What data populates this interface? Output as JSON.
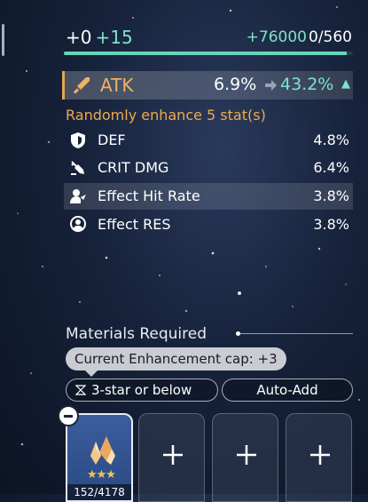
{
  "enhance": {
    "level_current": "+0",
    "level_added": "+15",
    "exp_gain": "+76000",
    "exp_value": "0/560",
    "exp_progress": 0.98
  },
  "main_stat": {
    "icon": "sword-icon",
    "name": "ATK",
    "from": "6.9%",
    "to": "43.2%",
    "trend_icon": "up-triangle-icon"
  },
  "random_note": "Randomly enhance 5 stat(s)",
  "substats": [
    {
      "icon": "shield-icon",
      "name": "DEF",
      "value": "4.8%",
      "highlight": false
    },
    {
      "icon": "crit-dmg-icon",
      "name": "CRIT DMG",
      "value": "6.4%",
      "highlight": false
    },
    {
      "icon": "effect-hit-icon",
      "name": "Effect Hit Rate",
      "value": "3.8%",
      "highlight": true
    },
    {
      "icon": "effect-res-icon",
      "name": "Effect RES",
      "value": "3.8%",
      "highlight": false
    }
  ],
  "materials": {
    "title": "Materials Required",
    "cap_tooltip": "Current Enhancement cap: +3",
    "filter_label": "3-star or below",
    "auto_add_label": "Auto-Add",
    "slots": [
      {
        "type": "material",
        "icon": "fuel-crystal-icon",
        "stars": "★★★",
        "count": "152/4178"
      },
      {
        "type": "empty"
      },
      {
        "type": "empty"
      },
      {
        "type": "empty"
      }
    ]
  },
  "colors": {
    "accent_teal": "#7fe3c9",
    "accent_orange": "#f0a94a",
    "main_stat_gold": "#f0b25e"
  }
}
